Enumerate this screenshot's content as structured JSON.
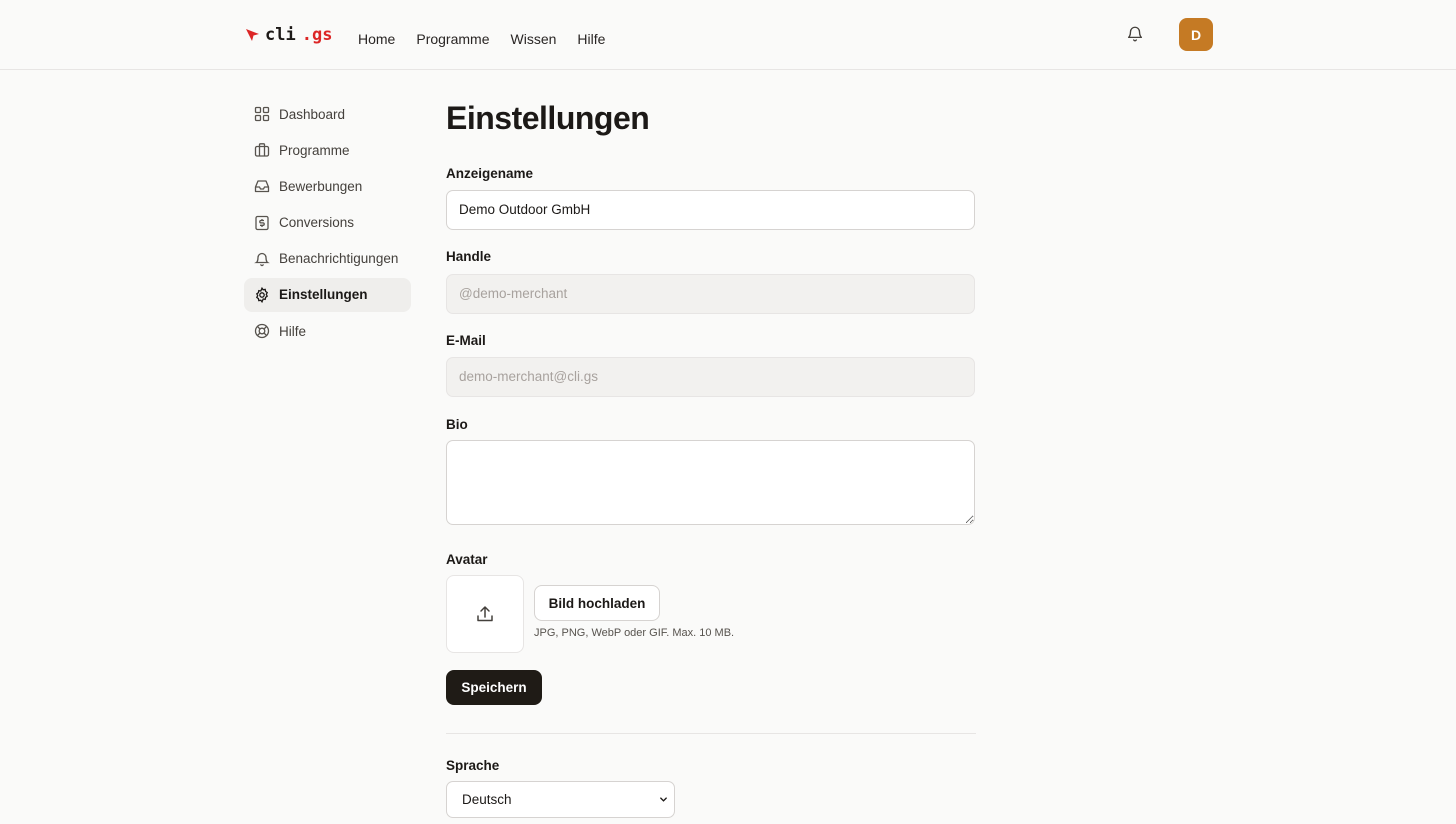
{
  "brand": {
    "name_main": "cli",
    "name_suffix": ".gs",
    "accent": "#dc2626"
  },
  "nav": {
    "items": [
      "Home",
      "Programme",
      "Wissen",
      "Hilfe"
    ]
  },
  "header": {
    "avatar_initial": "D",
    "avatar_color": "#c57a24",
    "notification_icon": "bell-icon"
  },
  "sidebar": {
    "items": [
      {
        "label": "Dashboard",
        "icon": "grid-icon"
      },
      {
        "label": "Programme",
        "icon": "briefcase-icon"
      },
      {
        "label": "Bewerbungen",
        "icon": "inbox-icon"
      },
      {
        "label": "Conversions",
        "icon": "dollar-receipt-icon"
      },
      {
        "label": "Benachrichtigungen",
        "icon": "bell-icon"
      },
      {
        "label": "Einstellungen",
        "icon": "gear-icon",
        "active": true
      },
      {
        "label": "Hilfe",
        "icon": "lifebuoy-icon"
      }
    ]
  },
  "main": {
    "title": "Einstellungen",
    "display_name": {
      "label": "Anzeigename",
      "value": "Demo Outdoor GmbH"
    },
    "handle": {
      "label": "Handle",
      "value": "@demo-merchant"
    },
    "email": {
      "label": "E-Mail",
      "value": "demo-merchant@cli.gs"
    },
    "bio": {
      "label": "Bio",
      "value": ""
    },
    "avatar": {
      "label": "Avatar",
      "upload_label": "Bild hochladen",
      "hint": "JPG, PNG, WebP oder GIF. Max. 10 MB."
    },
    "save_label": "Speichern",
    "language": {
      "label": "Sprache",
      "value": "Deutsch"
    }
  }
}
